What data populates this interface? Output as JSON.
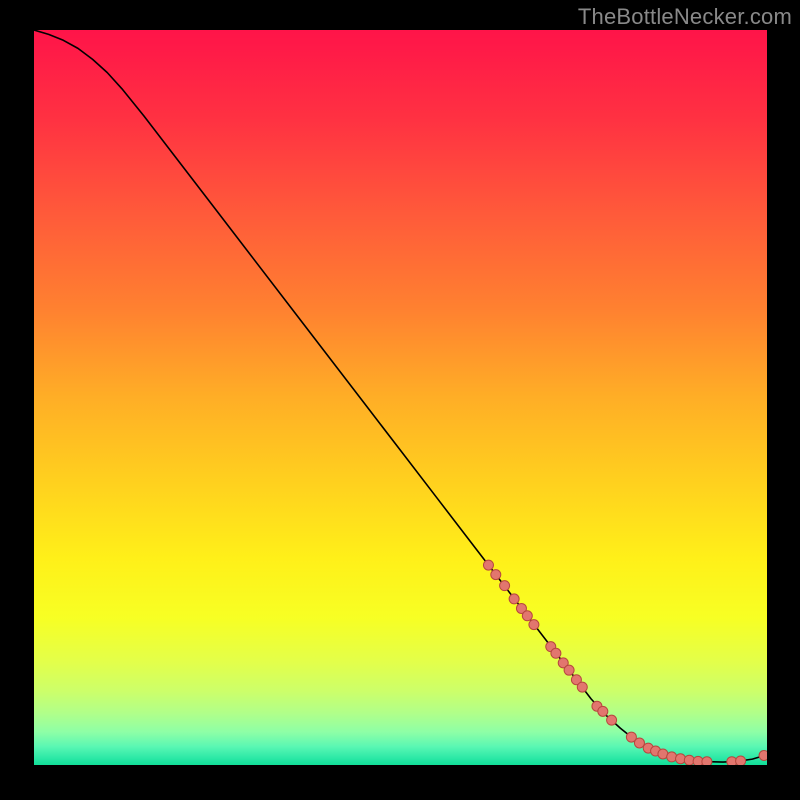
{
  "watermark": "TheBottleNecker.com",
  "chart_data": {
    "type": "line",
    "title": "",
    "xlabel": "",
    "ylabel": "",
    "xlim": [
      0,
      100
    ],
    "ylim": [
      0,
      100
    ],
    "grid": false,
    "legend": false,
    "series": [
      {
        "name": "curve",
        "x": [
          0,
          2,
          4,
          6,
          8,
          10,
          12,
          15,
          20,
          25,
          30,
          35,
          40,
          45,
          50,
          55,
          60,
          65,
          70,
          72,
          74,
          76,
          78,
          80,
          82,
          84,
          86,
          88,
          90,
          92,
          94,
          96,
          98,
          100
        ],
        "y": [
          100,
          99.4,
          98.6,
          97.5,
          96.0,
          94.2,
          92.0,
          88.3,
          81.8,
          75.3,
          68.8,
          62.3,
          55.8,
          49.3,
          42.8,
          36.3,
          29.8,
          23.3,
          16.8,
          14.2,
          11.6,
          9.0,
          6.8,
          5.0,
          3.4,
          2.2,
          1.4,
          0.9,
          0.6,
          0.45,
          0.4,
          0.5,
          0.8,
          1.4
        ],
        "color": "#000000",
        "width": 1.6
      }
    ],
    "markers": [
      {
        "x": 62.0,
        "y": 27.2,
        "r": 5
      },
      {
        "x": 63.0,
        "y": 25.9,
        "r": 5
      },
      {
        "x": 64.2,
        "y": 24.4,
        "r": 5
      },
      {
        "x": 65.5,
        "y": 22.6,
        "r": 5
      },
      {
        "x": 66.5,
        "y": 21.3,
        "r": 5
      },
      {
        "x": 67.3,
        "y": 20.3,
        "r": 5
      },
      {
        "x": 68.2,
        "y": 19.1,
        "r": 5
      },
      {
        "x": 70.5,
        "y": 16.1,
        "r": 5
      },
      {
        "x": 71.2,
        "y": 15.2,
        "r": 5
      },
      {
        "x": 72.2,
        "y": 13.9,
        "r": 5
      },
      {
        "x": 73.0,
        "y": 12.9,
        "r": 5
      },
      {
        "x": 74.0,
        "y": 11.6,
        "r": 5
      },
      {
        "x": 74.8,
        "y": 10.6,
        "r": 5
      },
      {
        "x": 76.8,
        "y": 8.0,
        "r": 5
      },
      {
        "x": 77.6,
        "y": 7.3,
        "r": 5
      },
      {
        "x": 78.8,
        "y": 6.1,
        "r": 5
      },
      {
        "x": 81.5,
        "y": 3.8,
        "r": 5
      },
      {
        "x": 82.6,
        "y": 3.0,
        "r": 5
      },
      {
        "x": 83.8,
        "y": 2.3,
        "r": 5
      },
      {
        "x": 84.8,
        "y": 1.9,
        "r": 5
      },
      {
        "x": 85.8,
        "y": 1.5,
        "r": 5
      },
      {
        "x": 87.0,
        "y": 1.1,
        "r": 5
      },
      {
        "x": 88.2,
        "y": 0.85,
        "r": 5
      },
      {
        "x": 89.4,
        "y": 0.65,
        "r": 5
      },
      {
        "x": 90.6,
        "y": 0.5,
        "r": 5
      },
      {
        "x": 91.8,
        "y": 0.45,
        "r": 5
      },
      {
        "x": 95.2,
        "y": 0.45,
        "r": 5
      },
      {
        "x": 96.4,
        "y": 0.55,
        "r": 5
      },
      {
        "x": 99.6,
        "y": 1.3,
        "r": 5
      }
    ],
    "marker_style": {
      "fill": "#e2766e",
      "stroke": "#b7473e",
      "stroke_width": 1
    },
    "background_gradient": {
      "stops": [
        {
          "offset": 0.0,
          "color": "#ff1449"
        },
        {
          "offset": 0.12,
          "color": "#ff3142"
        },
        {
          "offset": 0.25,
          "color": "#ff5a3a"
        },
        {
          "offset": 0.38,
          "color": "#ff8130"
        },
        {
          "offset": 0.5,
          "color": "#ffae26"
        },
        {
          "offset": 0.62,
          "color": "#ffd21e"
        },
        {
          "offset": 0.72,
          "color": "#fff019"
        },
        {
          "offset": 0.8,
          "color": "#f7ff24"
        },
        {
          "offset": 0.86,
          "color": "#e3ff4a"
        },
        {
          "offset": 0.9,
          "color": "#ccff6a"
        },
        {
          "offset": 0.93,
          "color": "#b0ff8a"
        },
        {
          "offset": 0.955,
          "color": "#8effa6"
        },
        {
          "offset": 0.975,
          "color": "#5af7b3"
        },
        {
          "offset": 0.99,
          "color": "#2de9a7"
        },
        {
          "offset": 1.0,
          "color": "#11df98"
        }
      ]
    }
  }
}
